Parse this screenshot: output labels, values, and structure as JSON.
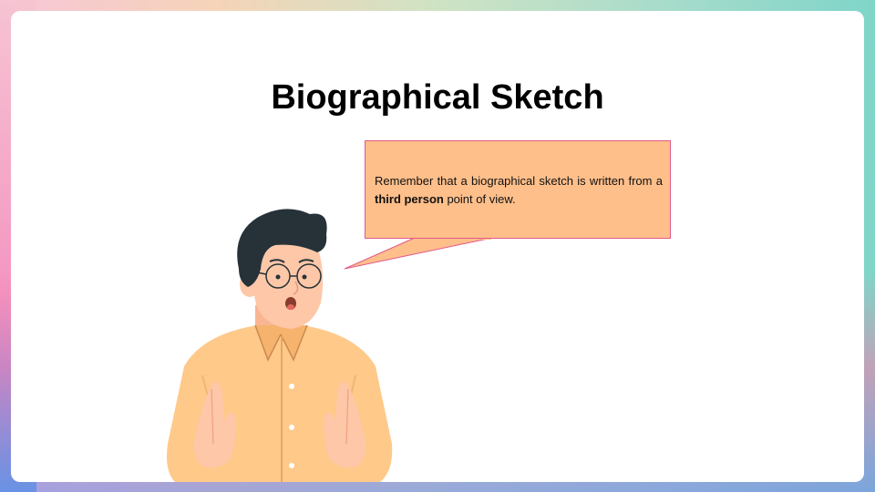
{
  "slide": {
    "title": "Biographical Sketch",
    "bubble": {
      "text_before": "Remember that a biographical sketch is written from a ",
      "text_bold": "third person",
      "text_after": " point of view."
    },
    "illustration": {
      "icon": "man-talking-illustration"
    }
  },
  "colors": {
    "bubble_fill": "#ffbf8a",
    "bubble_border": "#e0588a",
    "shirt": "#ffc98a",
    "skin": "#fdc7a8",
    "hair": "#263238"
  }
}
